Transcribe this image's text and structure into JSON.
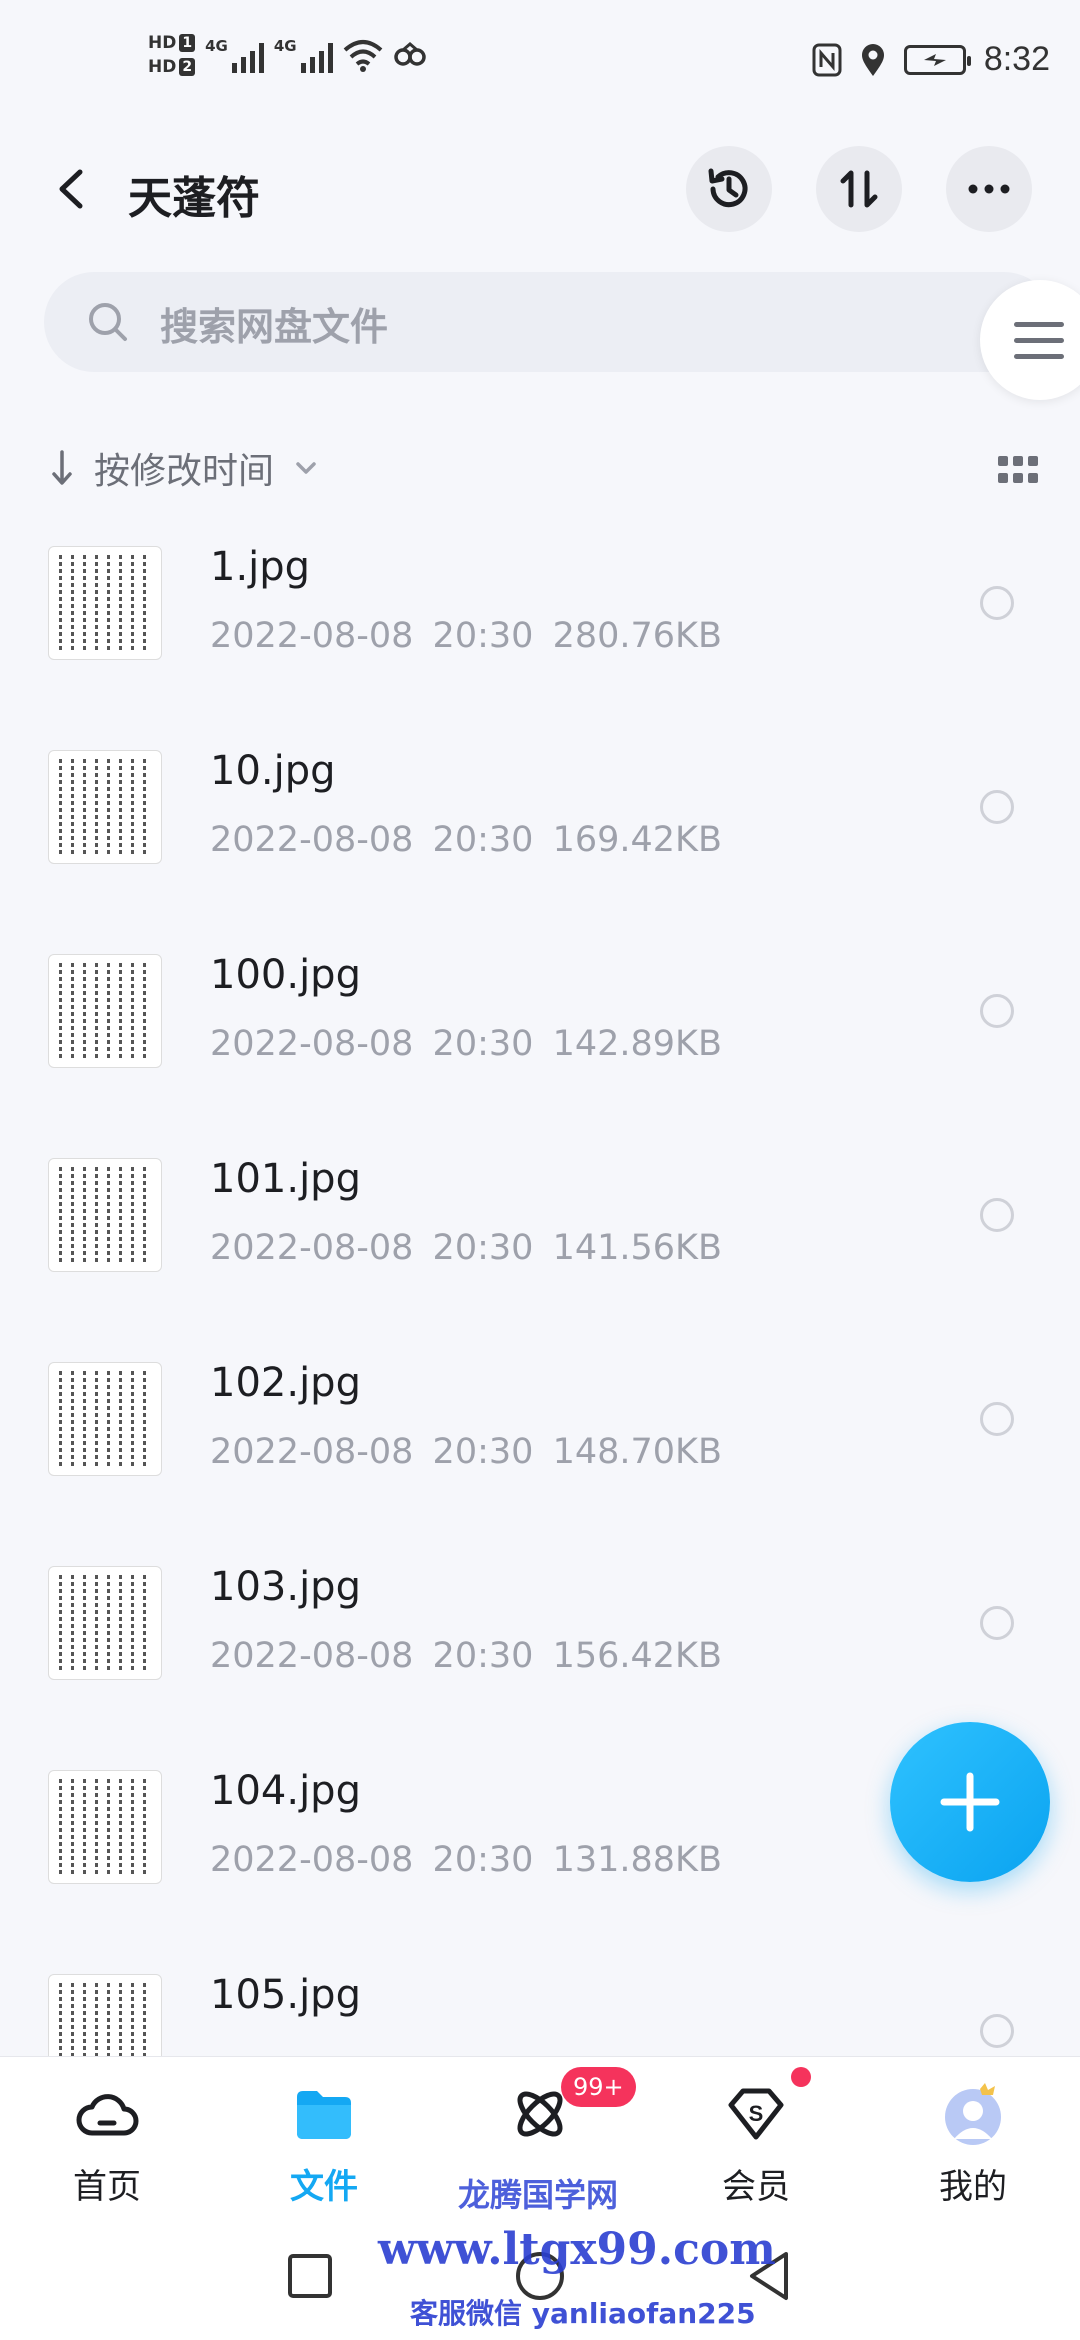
{
  "status_bar": {
    "hd1": "HD",
    "hd1_num": "1",
    "hd2": "HD",
    "hd2_num": "2",
    "net1": "4G",
    "net2": "4G",
    "time": "8:32"
  },
  "header": {
    "title": "天蓬符",
    "history_icon": "history-icon",
    "sort_icon": "swap-vertical-icon",
    "more_icon": "more-icon"
  },
  "search": {
    "placeholder": "搜索网盘文件"
  },
  "sort": {
    "label": "按修改时间"
  },
  "files": [
    {
      "name": "1.jpg",
      "date": "2022-08-08",
      "time": "20:30",
      "size": "280.76KB"
    },
    {
      "name": "10.jpg",
      "date": "2022-08-08",
      "time": "20:30",
      "size": "169.42KB"
    },
    {
      "name": "100.jpg",
      "date": "2022-08-08",
      "time": "20:30",
      "size": "142.89KB"
    },
    {
      "name": "101.jpg",
      "date": "2022-08-08",
      "time": "20:30",
      "size": "141.56KB"
    },
    {
      "name": "102.jpg",
      "date": "2022-08-08",
      "time": "20:30",
      "size": "148.70KB"
    },
    {
      "name": "103.jpg",
      "date": "2022-08-08",
      "time": "20:30",
      "size": "156.42KB"
    },
    {
      "name": "104.jpg",
      "date": "2022-08-08",
      "time": "20:30",
      "size": "131.88KB"
    },
    {
      "name": "105.jpg",
      "date": "",
      "time": "",
      "size": ""
    }
  ],
  "bottom_nav": [
    {
      "label": "首页",
      "icon": "cloud-icon"
    },
    {
      "label": "文件",
      "icon": "folder-icon",
      "active": true
    },
    {
      "label": "",
      "icon": "planet-icon",
      "badge": "99+"
    },
    {
      "label": "会员",
      "icon": "vip-diamond-icon",
      "dot": true
    },
    {
      "label": "我的",
      "icon": "avatar-icon"
    }
  ],
  "colors": {
    "accent": "#14a8f3",
    "badge": "#f5335c",
    "background": "#f6f7fb"
  },
  "watermark": {
    "line1": "龙腾国学网",
    "line2": "www.ltgx99.com",
    "line3": "客服微信 yanliaofan225"
  }
}
